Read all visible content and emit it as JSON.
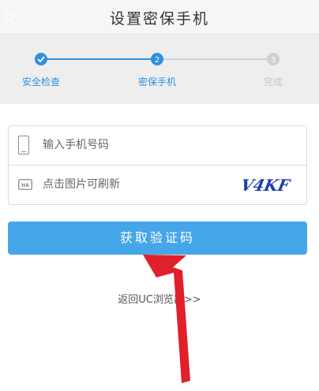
{
  "header": {
    "title": "设置密保手机"
  },
  "steps": [
    {
      "label": "安全检查",
      "number": "",
      "state": "done"
    },
    {
      "label": "密保手机",
      "number": "2",
      "state": "current"
    },
    {
      "label": "完成",
      "number": "3",
      "state": "pending"
    }
  ],
  "form": {
    "phone_placeholder": "输入手机号码",
    "captcha_placeholder": "点击图片可刷新",
    "captcha_text": "V4KF"
  },
  "button": {
    "label": "获取验证码"
  },
  "back_link": {
    "label": "返回UC浏览器>>"
  },
  "colors": {
    "accent": "#45a6e9",
    "step_active": "#2f8fe0",
    "arrow": "#e0202a"
  }
}
